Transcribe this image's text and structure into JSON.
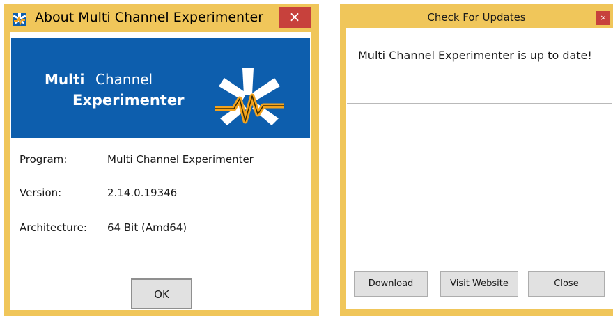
{
  "about": {
    "title": "About Multi Channel Experimenter",
    "close_glyph": "×",
    "banner": {
      "word1": "Multi",
      "word2": "Channel",
      "word3": "Experimenter"
    },
    "info": [
      {
        "label": "Program:",
        "value": "Multi Channel Experimenter"
      },
      {
        "label": "Version:",
        "value": "2.14.0.19346"
      },
      {
        "label": "Architecture:",
        "value": "64 Bit (Amd64)"
      }
    ],
    "ok_label": "OK",
    "icon": "app-logo-icon"
  },
  "updates": {
    "title": "Check For Updates",
    "close_glyph": "×",
    "message": "Multi Channel Experimenter is up to date!",
    "buttons": {
      "download": "Download",
      "visit_website": "Visit Website",
      "close": "Close"
    }
  },
  "colors": {
    "window_frame": "#f0c65a",
    "close_button": "#c7413c",
    "banner": "#0d5ead",
    "logo_wave": "#f4a31c"
  }
}
